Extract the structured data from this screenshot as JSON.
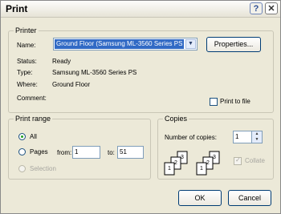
{
  "window": {
    "title": "Print"
  },
  "titlebar": {
    "help_label": "?",
    "close_label": "✕"
  },
  "printer": {
    "group_label": "Printer",
    "name_label": "Name:",
    "name_value": "Ground Floor (Samsung ML-3560 Series PS",
    "properties_label": "Properties...",
    "status_label": "Status:",
    "status_value": "Ready",
    "type_label": "Type:",
    "type_value": "Samsung ML-3560 Series PS",
    "where_label": "Where:",
    "where_value": "Ground Floor",
    "comment_label": "Comment:",
    "print_to_file_label": "Print to file"
  },
  "print_range": {
    "group_label": "Print range",
    "all_label": "All",
    "pages_label": "Pages",
    "from_label": "from:",
    "from_value": "1",
    "to_label": "to:",
    "to_value": "51",
    "selection_label": "Selection"
  },
  "copies": {
    "group_label": "Copies",
    "number_label": "Number of copies:",
    "number_value": "1",
    "collate_label": "Collate",
    "collate_icon_digits": [
      "1",
      "2",
      "3"
    ]
  },
  "buttons": {
    "ok_label": "OK",
    "cancel_label": "Cancel"
  },
  "icons": {
    "dropdown": "chevron-down-icon",
    "spin_up": "spin-up-icon",
    "spin_down": "spin-down-icon"
  }
}
